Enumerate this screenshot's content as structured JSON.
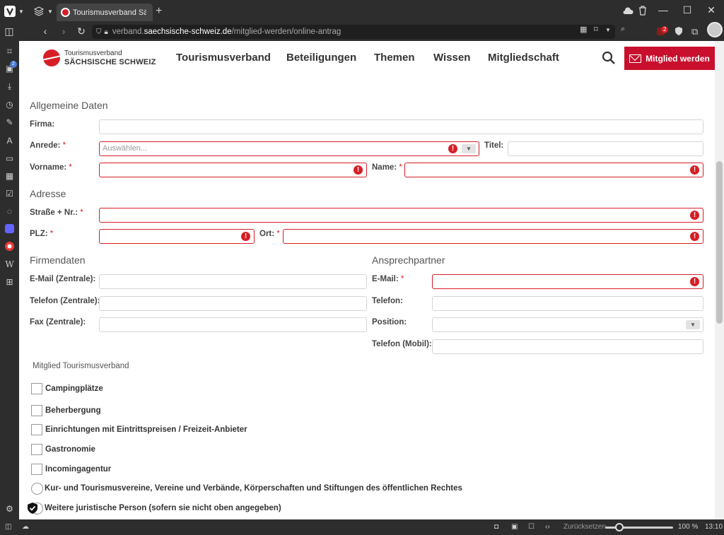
{
  "browser": {
    "tab": {
      "title": "Tourismusverband Sächsische Schweiz"
    },
    "url": {
      "prefix": "verband.",
      "host": "saechsische-schweiz.de",
      "path": "/mitglied-werden/online-antrag"
    },
    "leftbar_badge": "2",
    "extension_badge": "2",
    "status": {
      "reset_label": "Zurücksetzen",
      "zoom": "100 %",
      "time": "13:10"
    }
  },
  "header": {
    "logo_line1": "Tourismusverband",
    "logo_line2": "SÄCHSISCHE SCHWEIZ",
    "nav": [
      "Tourismusverband",
      "Beteiligungen",
      "Themen",
      "Wissen",
      "Mitgliedschaft"
    ],
    "cta": "Mitglied werden"
  },
  "form": {
    "sections": {
      "general": "Allgemeine Daten",
      "address": "Adresse",
      "company": "Firmendaten",
      "contact": "Ansprechpartner"
    },
    "labels": {
      "firma": "Firma:",
      "anrede": "Anrede:",
      "titel": "Titel:",
      "vorname": "Vorname:",
      "name": "Name:",
      "strasse": "Straße + Nr.:",
      "plz": "PLZ:",
      "ort": "Ort:",
      "email_zentrale": "E-Mail (Zentrale):",
      "telefon_zentrale": "Telefon (Zentrale):",
      "fax_zentrale": "Fax (Zentrale):",
      "email": "E-Mail:",
      "telefon": "Telefon:",
      "position": "Position:",
      "telefon_mobil": "Telefon (Mobil):"
    },
    "required_mark": "*",
    "error_mark": "!",
    "anrede_placeholder": "Auswählen...",
    "dropdown_arrow": "▼",
    "membership_title": "Mitglied Tourismusverband",
    "membership_options": [
      "Campingplätze",
      "Beherbergung",
      "Einrichtungen mit Eintrittspreisen / Freizeit-Anbieter",
      "Gastronomie",
      "Incomingagentur",
      "Kur- und Tourismusvereine, Vereine und Verbände, Körperschaften und Stiftungen des öffentlichen Rechtes",
      "Weitere juristische Person (sofern sie nicht oben angegeben)"
    ]
  },
  "colors": {
    "brand_red": "#c8102e",
    "error_red": "#d61f26",
    "chrome": "#2d2d2d"
  }
}
